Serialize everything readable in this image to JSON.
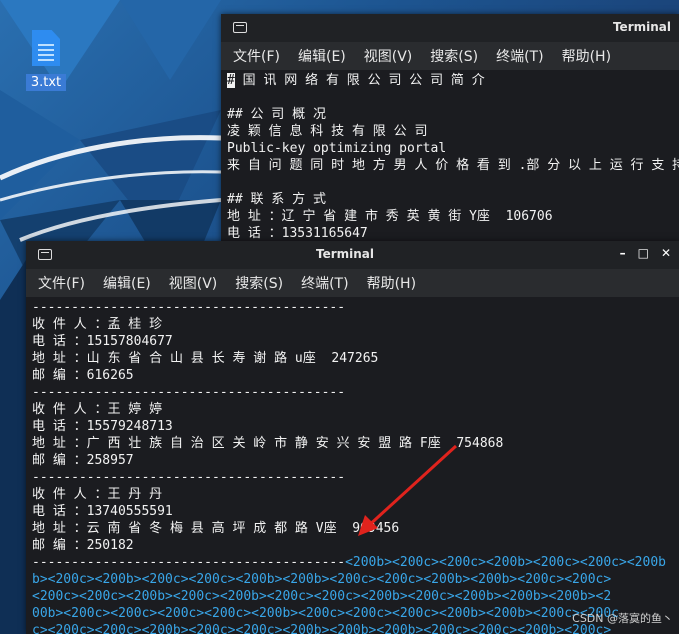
{
  "desktop": {
    "file_icon_label": "3.txt",
    "icon": "text-file-icon"
  },
  "back_terminal": {
    "title": "Terminal",
    "menu": [
      "文件(F)",
      "编辑(E)",
      "视图(V)",
      "搜索(S)",
      "终端(T)",
      "帮助(H)"
    ],
    "cursor_char": "#",
    "lines": [
      " 国 讯 网 络 有 限 公 司 公 司 简 介",
      "",
      "## 公 司 概 况",
      "凌 颖 信 息 科 技 有 限 公 司",
      "Public-key optimizing portal",
      "来 自 问 题 同 时 地 方 男 人 价 格 看 到 .部 分 以 上 运 行 支 持 政 府 资 源 政 府",
      "",
      "## 联 系 方 式",
      "地 址 ：辽 宁 省 建 市 秀 英 黄 街 Y座  106706",
      "电 话 ：13531165647"
    ]
  },
  "front_terminal": {
    "title": "Terminal",
    "menu": [
      "文件(F)",
      "编辑(E)",
      "视图(V)",
      "搜索(S)",
      "终端(T)",
      "帮助(H)"
    ],
    "window_buttons": [
      "–",
      "□",
      "✕"
    ],
    "lines": [
      "----------------------------------------",
      "收 件 人 ：孟 桂 珍",
      "电 话 ：15157804677",
      "地 址 ：山 东 省 合 山 县 长 寿 谢 路 u座  247265",
      "邮 编 ：616265",
      "----------------------------------------",
      "收 件 人 ：王 婷 婷",
      "电 话 ：15579248713",
      "地 址 ：广 西 壮 族 自 治 区 关 岭 市 静 安 兴 安 盟 路 F座  754868",
      "邮 编 ：258957",
      "----------------------------------------",
      "收 件 人 ：王 丹 丹",
      "电 话 ：13740555591",
      "地 址 ：云 南 省 冬 梅 县 高 坪 成 都 路 V座  969456",
      "邮 编 ：250182"
    ],
    "separator_prefix": "----------------------------------------",
    "separator_blue": "<200b><200c><200c><200b><200c><200c><200b",
    "blue_lines": [
      "b><200c><200b><200c><200c><200b><200b><200c><200c><200b><200b><200c><200c>",
      "<200c><200c><200b><200c><200b><200c><200c><200b><200c><200b><200b><200b><2",
      "00b><200c><200c><200c><200c><200b><200c><200c><200c><200b><200b><200c><200c",
      "c><200c><200c><200b><200c><200c><200b><200b><200b><200c><200c><200b><200c>"
    ]
  },
  "watermark": "CSDN @落寞的鱼丶",
  "colors": {
    "terminal_bg": "#1b1c20",
    "highlight_blue": "#39a6e8",
    "arrow_red": "#e0231d"
  }
}
